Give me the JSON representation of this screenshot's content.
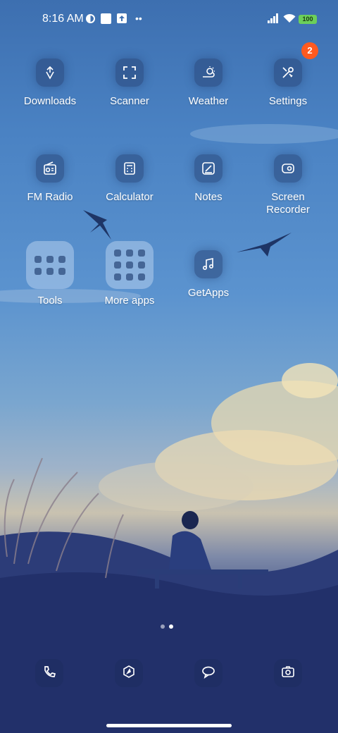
{
  "status_bar": {
    "time": "8:16 AM",
    "battery": "100"
  },
  "apps": [
    {
      "label": "Downloads",
      "icon": "download-icon"
    },
    {
      "label": "Scanner",
      "icon": "scanner-icon"
    },
    {
      "label": "Weather",
      "icon": "weather-icon"
    },
    {
      "label": "Settings",
      "icon": "settings-icon"
    },
    {
      "label": "FM Radio",
      "icon": "radio-icon"
    },
    {
      "label": "Calculator",
      "icon": "calculator-icon"
    },
    {
      "label": "Notes",
      "icon": "notes-icon"
    },
    {
      "label": "Screen Recorder",
      "icon": "screen-recorder-icon"
    },
    {
      "label": "Tools",
      "icon": "folder-icon"
    },
    {
      "label": "More apps",
      "icon": "folder-icon"
    },
    {
      "label": "GetApps",
      "icon": "music-note-icon"
    }
  ],
  "settings_badge": "2",
  "dock": [
    {
      "icon": "phone-icon"
    },
    {
      "icon": "browser-icon"
    },
    {
      "icon": "messages-icon"
    },
    {
      "icon": "camera-icon"
    }
  ],
  "colors": {
    "accent_badge": "#ff5a1f",
    "battery": "#6ccf5a"
  }
}
